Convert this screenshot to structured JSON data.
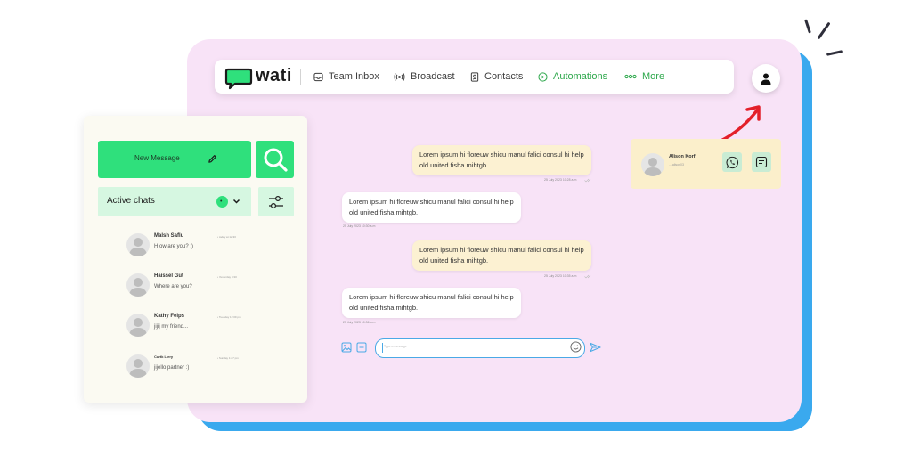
{
  "brand": {
    "name": "wati"
  },
  "nav": {
    "items": [
      {
        "label": "Team Inbox",
        "icon": "inbox-icon"
      },
      {
        "label": "Broadcast",
        "icon": "broadcast-icon"
      },
      {
        "label": "Contacts",
        "icon": "contacts-icon"
      },
      {
        "label": "Automations",
        "icon": "play-circle-icon"
      },
      {
        "label": "More",
        "icon": "more-dots-icon"
      }
    ]
  },
  "sidebar": {
    "new_message_label": "New Message",
    "active_chats_label": "Active chats",
    "active_count": "•",
    "chats": [
      {
        "name": "Malsh Saflu",
        "message": "H ow are you? :)",
        "time": "• today at 12:30"
      },
      {
        "name": "Haissel Gut",
        "message": "Where are you?",
        "time": "• Yesterday 8:30"
      },
      {
        "name": "Kathy Felps",
        "message": "jijij my friend...",
        "time": "• Tuesday 12:09 pm"
      },
      {
        "name": "Curtk Liery",
        "message": "jijello partner :)",
        "time": "• Sunday 1:27 pm"
      }
    ]
  },
  "conversation": {
    "messages": [
      {
        "direction": "out",
        "text": "Lorem ipsum hi floreuw shicu manul falici consul hi help old united fisha mihtgb.",
        "time": "25 July 2023 10:28 a.m"
      },
      {
        "direction": "in",
        "text": "Lorem ipsum hi floreuw shicu manul falici consul hi help old united fisha mihtgb.",
        "time": "25 July 2023 10:30 a.m"
      },
      {
        "direction": "out",
        "text": "Lorem ipsum hi floreuw shicu manul falici consul hi help old united fisha mihtgb.",
        "time": "25 July 2023 10:35 a.m"
      },
      {
        "direction": "in",
        "text": "Lorem ipsum hi floreuw shicu manul falici consul hi help old united fisha mihtgb.",
        "time": "25 July 2023 10:36 a.m"
      }
    ],
    "compose_placeholder": "Type a message"
  },
  "contact": {
    "name": "Alison Korf",
    "subtitle": "... alison03"
  },
  "colors": {
    "accent_green": "#2fe07c",
    "panel_pink": "#f8e3f7",
    "shadow_blue": "#3aa9ee",
    "arrow_red": "#e3202a",
    "outgoing_bubble": "#fcf1d2"
  }
}
